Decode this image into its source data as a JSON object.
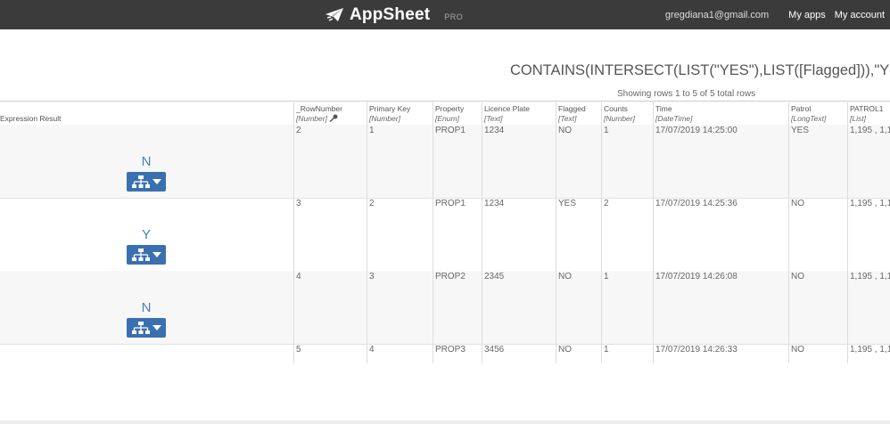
{
  "header": {
    "brand": "AppSheet",
    "tier": "PRO",
    "email": "gregdiana1@gmail.com",
    "links": [
      "My apps",
      "My account"
    ]
  },
  "expression": "CONTAINS(INTERSECT(LIST(\"YES\"),LIST([Flagged])),\"YES\")",
  "rows_info": "Showing rows 1 to 5 of 5 total rows",
  "table": {
    "expr_header": "Expression Result",
    "columns": [
      {
        "name": "_RowNumber",
        "type": "[Number]"
      },
      {
        "name": "Primary Key",
        "type": "[Number]"
      },
      {
        "name": "Property",
        "type": "[Enum]"
      },
      {
        "name": "Licence Plate",
        "type": "[Text]"
      },
      {
        "name": "Flagged",
        "type": "[Text]"
      },
      {
        "name": "Counts",
        "type": "[Number]"
      },
      {
        "name": "Time",
        "type": "[DateTime]"
      },
      {
        "name": "Patrol",
        "type": "[LongText]"
      },
      {
        "name": "PATROL1",
        "type": "[List]"
      }
    ],
    "rows": [
      {
        "result": "N",
        "cells": [
          "2",
          "1",
          "PROP1",
          "1234",
          "NO",
          "1",
          "17/07/2019 14:25:00",
          "YES",
          "1,195 , 1,1"
        ]
      },
      {
        "result": "Y",
        "cells": [
          "3",
          "2",
          "PROP1",
          "1234",
          "YES",
          "2",
          "17/07/2019 14:25:36",
          "NO",
          "1,195 , 1,1"
        ]
      },
      {
        "result": "N",
        "cells": [
          "4",
          "3",
          "PROP2",
          "2345",
          "NO",
          "1",
          "17/07/2019 14:26:08",
          "NO",
          "1,195 , 1,1"
        ]
      },
      {
        "result": "",
        "cells": [
          "5",
          "4",
          "PROP3",
          "3456",
          "NO",
          "1",
          "17/07/2019 14:26:33",
          "NO",
          "1,195 , 1,1"
        ]
      }
    ]
  },
  "colors": {
    "topbar": "#3b3b3b",
    "accent": "#3a70b0",
    "result_text": "#4a7fb6"
  }
}
